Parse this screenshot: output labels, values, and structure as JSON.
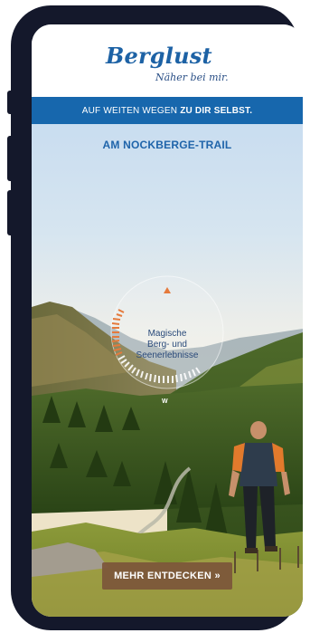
{
  "brand": {
    "name": "Berglust",
    "slogan": "Näher bei mir."
  },
  "tagline": {
    "lead": "AUF WEITEN WEGEN",
    "emphasis": "ZU DIR SELBST."
  },
  "hero": {
    "title": "AM NOCKBERGE-TRAIL",
    "dial": {
      "line1": "Magische",
      "line2": "Berg- und",
      "line3": "Seenerlebnisse",
      "direction": "W"
    },
    "cta_label": "MEHR ENTDECKEN »"
  },
  "colors": {
    "brand_blue": "#1767ad",
    "cta_brown": "#7c563a",
    "dial_accent": "#e57a3c",
    "device_frame": "#14182b"
  }
}
